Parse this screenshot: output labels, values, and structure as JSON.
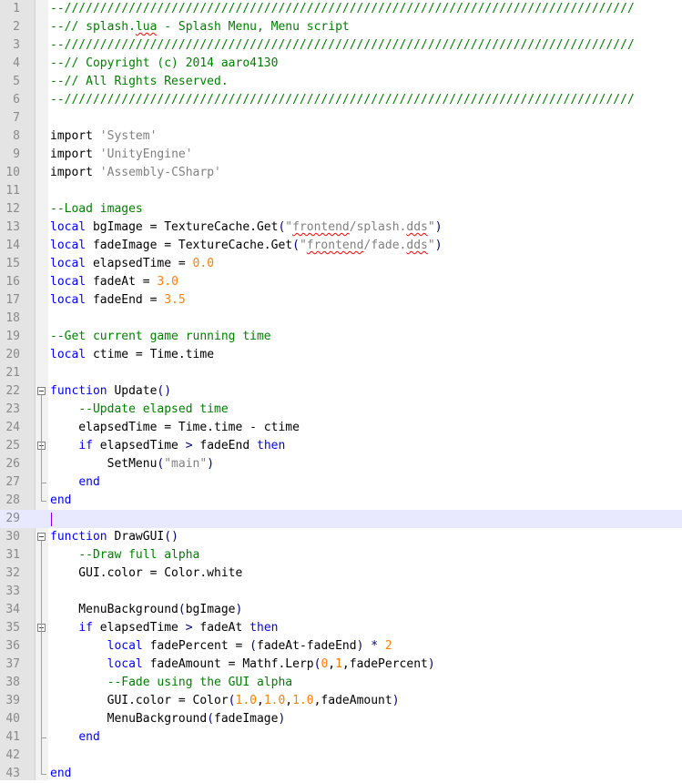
{
  "editor": {
    "lines": [
      {
        "no": "1",
        "tokens": [
          [
            "c",
            "--////////////////////////////////////////////////////////////////////////////////"
          ]
        ]
      },
      {
        "no": "2",
        "tokens": [
          [
            "c",
            "--// splash."
          ],
          [
            "c sp",
            "lua"
          ],
          [
            "c",
            " - Splash Menu, Menu script"
          ]
        ]
      },
      {
        "no": "3",
        "tokens": [
          [
            "c",
            "--////////////////////////////////////////////////////////////////////////////////"
          ]
        ]
      },
      {
        "no": "4",
        "tokens": [
          [
            "c",
            "--// Copyright (c) 2014 aaro4130"
          ]
        ]
      },
      {
        "no": "5",
        "tokens": [
          [
            "c",
            "--// All Rights Reserved."
          ]
        ]
      },
      {
        "no": "6",
        "tokens": [
          [
            "c",
            "--////////////////////////////////////////////////////////////////////////////////"
          ]
        ]
      },
      {
        "no": "7",
        "tokens": []
      },
      {
        "no": "8",
        "tokens": [
          [
            "",
            "import "
          ],
          [
            "s",
            "'System'"
          ]
        ]
      },
      {
        "no": "9",
        "tokens": [
          [
            "",
            "import "
          ],
          [
            "s",
            "'UnityEngine'"
          ]
        ]
      },
      {
        "no": "10",
        "tokens": [
          [
            "",
            "import "
          ],
          [
            "s",
            "'Assembly-CSharp'"
          ]
        ]
      },
      {
        "no": "11",
        "tokens": []
      },
      {
        "no": "12",
        "tokens": [
          [
            "c",
            "--Load images"
          ]
        ]
      },
      {
        "no": "13",
        "tokens": [
          [
            "k",
            "local"
          ],
          [
            "",
            " bgImage = TextureCache.Get"
          ],
          [
            "o",
            "("
          ],
          [
            "s",
            "\""
          ],
          [
            "s sp",
            "frontend"
          ],
          [
            "s",
            "/splash."
          ],
          [
            "s sp",
            "dds"
          ],
          [
            "s",
            "\""
          ],
          [
            "o",
            ")"
          ]
        ]
      },
      {
        "no": "14",
        "tokens": [
          [
            "k",
            "local"
          ],
          [
            "",
            " fadeImage = TextureCache.Get"
          ],
          [
            "o",
            "("
          ],
          [
            "s",
            "\""
          ],
          [
            "s sp",
            "frontend"
          ],
          [
            "s",
            "/fade."
          ],
          [
            "s sp",
            "dds"
          ],
          [
            "s",
            "\""
          ],
          [
            "o",
            ")"
          ]
        ]
      },
      {
        "no": "15",
        "tokens": [
          [
            "k",
            "local"
          ],
          [
            "",
            " elapsedTime = "
          ],
          [
            "n",
            "0.0"
          ]
        ]
      },
      {
        "no": "16",
        "tokens": [
          [
            "k",
            "local"
          ],
          [
            "",
            " fadeAt = "
          ],
          [
            "n",
            "3.0"
          ]
        ]
      },
      {
        "no": "17",
        "tokens": [
          [
            "k",
            "local"
          ],
          [
            "",
            " fadeEnd = "
          ],
          [
            "n",
            "3.5"
          ]
        ]
      },
      {
        "no": "18",
        "tokens": []
      },
      {
        "no": "19",
        "tokens": [
          [
            "c",
            "--Get current game running time"
          ]
        ]
      },
      {
        "no": "20",
        "tokens": [
          [
            "k",
            "local"
          ],
          [
            "",
            " ctime = Time.time"
          ]
        ]
      },
      {
        "no": "21",
        "tokens": []
      },
      {
        "no": "22",
        "tokens": [
          [
            "k",
            "function"
          ],
          [
            "",
            " Update"
          ],
          [
            "o",
            "()"
          ]
        ]
      },
      {
        "no": "23",
        "tokens": [
          [
            "ws",
            "    "
          ],
          [
            "c",
            "--Update elapsed time"
          ]
        ]
      },
      {
        "no": "24",
        "tokens": [
          [
            "",
            "    elapsedTime = Time.time - ctime"
          ]
        ]
      },
      {
        "no": "25",
        "tokens": [
          [
            "",
            "    "
          ],
          [
            "k",
            "if"
          ],
          [
            "",
            " elapsedTime "
          ],
          [
            "o",
            ">"
          ],
          [
            "",
            " fadeEnd "
          ],
          [
            "k",
            "then"
          ]
        ]
      },
      {
        "no": "26",
        "tokens": [
          [
            "",
            "        SetMenu"
          ],
          [
            "o",
            "("
          ],
          [
            "s",
            "\"main\""
          ],
          [
            "o",
            ")"
          ]
        ]
      },
      {
        "no": "27",
        "tokens": [
          [
            "",
            "    "
          ],
          [
            "k",
            "end"
          ]
        ]
      },
      {
        "no": "28",
        "tokens": [
          [
            "k",
            "end"
          ]
        ]
      },
      {
        "no": "29",
        "tokens": []
      },
      {
        "no": "30",
        "tokens": [
          [
            "k",
            "function"
          ],
          [
            "",
            " DrawGUI"
          ],
          [
            "o",
            "()"
          ]
        ]
      },
      {
        "no": "31",
        "tokens": [
          [
            "ws",
            "    "
          ],
          [
            "c",
            "--Draw full alpha"
          ]
        ]
      },
      {
        "no": "32",
        "tokens": [
          [
            "",
            "    GUI.color = Color.white"
          ]
        ]
      },
      {
        "no": "33",
        "tokens": []
      },
      {
        "no": "34",
        "tokens": [
          [
            "",
            "    MenuBackground"
          ],
          [
            "o",
            "("
          ],
          [
            "",
            "bgImage"
          ],
          [
            "o",
            ")"
          ]
        ]
      },
      {
        "no": "35",
        "tokens": [
          [
            "",
            "    "
          ],
          [
            "k",
            "if"
          ],
          [
            "",
            " elapsedTime "
          ],
          [
            "o",
            ">"
          ],
          [
            "",
            " fadeAt "
          ],
          [
            "k",
            "then"
          ]
        ]
      },
      {
        "no": "36",
        "tokens": [
          [
            "",
            "        "
          ],
          [
            "k",
            "local"
          ],
          [
            "",
            " fadePercent = "
          ],
          [
            "o",
            "("
          ],
          [
            "",
            "fadeAt-fadeEnd"
          ],
          [
            "o",
            ")"
          ],
          [
            "",
            " "
          ],
          [
            "o",
            "*"
          ],
          [
            "",
            " "
          ],
          [
            "n",
            "2"
          ]
        ]
      },
      {
        "no": "37",
        "tokens": [
          [
            "",
            "        "
          ],
          [
            "k",
            "local"
          ],
          [
            "",
            " fadeAmount = Mathf.Lerp"
          ],
          [
            "o",
            "("
          ],
          [
            "n",
            "0"
          ],
          [
            "",
            ","
          ],
          [
            "n",
            "1"
          ],
          [
            "",
            ",fadePercent"
          ],
          [
            "o",
            ")"
          ]
        ]
      },
      {
        "no": "38",
        "tokens": [
          [
            "ws",
            "        "
          ],
          [
            "c",
            "--Fade using the GUI alpha"
          ]
        ]
      },
      {
        "no": "39",
        "tokens": [
          [
            "",
            "        GUI.color = Color"
          ],
          [
            "o",
            "("
          ],
          [
            "n",
            "1.0"
          ],
          [
            "",
            ","
          ],
          [
            "n",
            "1.0"
          ],
          [
            "",
            ","
          ],
          [
            "n",
            "1.0"
          ],
          [
            "",
            ",fadeAmount"
          ],
          [
            "o",
            ")"
          ]
        ]
      },
      {
        "no": "40",
        "tokens": [
          [
            "",
            "        MenuBackground"
          ],
          [
            "o",
            "("
          ],
          [
            "",
            "fadeImage"
          ],
          [
            "o",
            ")"
          ]
        ]
      },
      {
        "no": "41",
        "tokens": [
          [
            "",
            "    "
          ],
          [
            "k",
            "end"
          ]
        ]
      },
      {
        "no": "42",
        "tokens": []
      },
      {
        "no": "43",
        "tokens": [
          [
            "k",
            "end"
          ]
        ]
      }
    ],
    "current_line": "29",
    "fold_markers": [
      "22",
      "25",
      "30",
      "35"
    ],
    "colors": {
      "comment": "#008000",
      "keyword": "#0000ff",
      "string": "#808080",
      "number": "#ff8000",
      "operator": "#000080",
      "current_line": "#e8e8ff"
    }
  }
}
